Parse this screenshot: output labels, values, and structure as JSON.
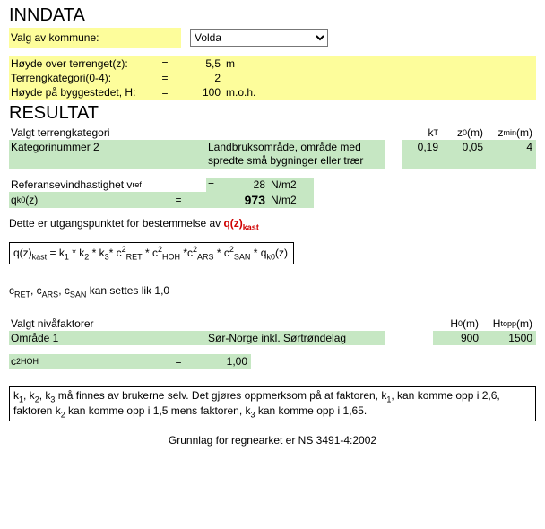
{
  "inn": {
    "title": "INNDATA",
    "valg_label": "Valg av kommune:",
    "kommune": "Volda",
    "hz_label": "Høyde over terrenget(z):",
    "hz_eq": "=",
    "hz_val": "5,5",
    "hz_unit": "m",
    "tk_label": "Terrengkategori(0-4):",
    "tk_eq": "=",
    "tk_val": "2",
    "hb_label": "Høyde på byggestedet, H:",
    "hb_eq": "=",
    "hb_val": "100",
    "hb_unit": "m.o.h."
  },
  "res": {
    "title": "RESULTAT",
    "vt_label": "Valgt terrengkategori",
    "kt_head": "k",
    "kt_head_sub": "T",
    "z0_head": "z",
    "z0_head_sub": "0",
    "z0_head_unit": "(m)",
    "zmin_head": "z",
    "zmin_head_sub": "min",
    "zmin_head_unit": "(m)",
    "kat_label": "Kategorinummer 2",
    "kat_desc": "Landbruksområde, område med spredte små bygninger eller trær",
    "kt_val": "0,19",
    "z0_val": "0,05",
    "zmin_val": "4",
    "vref_label_a": "Referansevindhastighet v",
    "vref_label_sub": "ref",
    "vref_eq": "=",
    "vref_val": "28",
    "vref_unit": "N/m2",
    "qk0_label_a": "q",
    "qk0_label_sub": "k0",
    "qk0_label_b": "(z)",
    "qk0_eq": "=",
    "qk0_val": "973",
    "qk0_unit": "N/m2",
    "utg_a": "Dette er utgangspunktiet for bestemmelse av ",
    "utg_fix": "Dette er utgangspunktet for bestemmelse av ",
    "utg_qz": "q(z)",
    "utg_qz_sub": "kast",
    "cnote": " kan settes lik 1,0",
    "niva_label": "Valgt nivåfaktorer",
    "h0_head": "H",
    "h0_head_sub": "0",
    "h0_unit": "(m)",
    "ht_head": "H",
    "ht_head_sub": "topp",
    "ht_unit": "(m)",
    "omr_label": "Område 1",
    "omr_val": "Sør-Norge inkl. Sørtrøndelag",
    "h0_val": "900",
    "ht_val": "1500",
    "c2hoh_a": "c",
    "c2hoh_sup": "2",
    "c2hoh_sub": "HOH",
    "c2hoh_eq": "=",
    "c2hoh_val": "1,00",
    "knote_a": "k",
    "knote_b": ", k",
    "knote_c": ", k",
    "knote_t1": " må finnes av brukerne selv. Det gjøres oppmerksom på at faktoren, k",
    "knote_t2": ", kan komme opp i 2,6, faktoren k",
    "knote_t3": " kan komme opp i 1,5 mens faktoren, k",
    "knote_t4": " kan komme opp i 1,65.",
    "footer": "Grunnlag for regnearket er NS 3491-4:2002"
  }
}
